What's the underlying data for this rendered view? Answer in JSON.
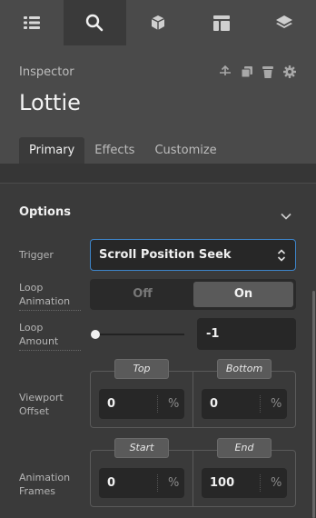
{
  "topbar": {
    "tabs": [
      {
        "icon": "list-icon",
        "active": false
      },
      {
        "icon": "search-icon",
        "active": true
      },
      {
        "icon": "cube-icon",
        "active": false
      },
      {
        "icon": "layout-icon",
        "active": false
      },
      {
        "icon": "layers-icon",
        "active": false
      }
    ]
  },
  "header": {
    "section_label": "Inspector",
    "element_title": "Lottie",
    "actions": [
      "move-up-icon",
      "duplicate-icon",
      "trash-icon",
      "gear-icon"
    ]
  },
  "tabs": [
    "Primary",
    "Effects",
    "Customize"
  ],
  "options": {
    "title": "Options",
    "trigger": {
      "label": "Trigger",
      "value": "Scroll Position Seek"
    },
    "loop_animation": {
      "label_line1": "Loop",
      "label_line2": "Animation",
      "off": "Off",
      "on": "On",
      "selected": "On"
    },
    "loop_amount": {
      "label_line1": "Loop",
      "label_line2": "Amount",
      "value": "-1",
      "slider_fraction": 0.0
    },
    "viewport_offset": {
      "label_line1": "Viewport",
      "label_line2": "Offset",
      "top_label": "Top",
      "bottom_label": "Bottom",
      "top_value": "0",
      "bottom_value": "0",
      "unit": "%"
    },
    "animation_frames": {
      "label_line1": "Animation",
      "label_line2": "Frames",
      "start_label": "Start",
      "end_label": "End",
      "start_value": "0",
      "end_value": "100",
      "unit": "%"
    }
  },
  "colors": {
    "accent": "#3d84c9",
    "panel": "#3a3a3a",
    "header": "#4a4a4a"
  }
}
